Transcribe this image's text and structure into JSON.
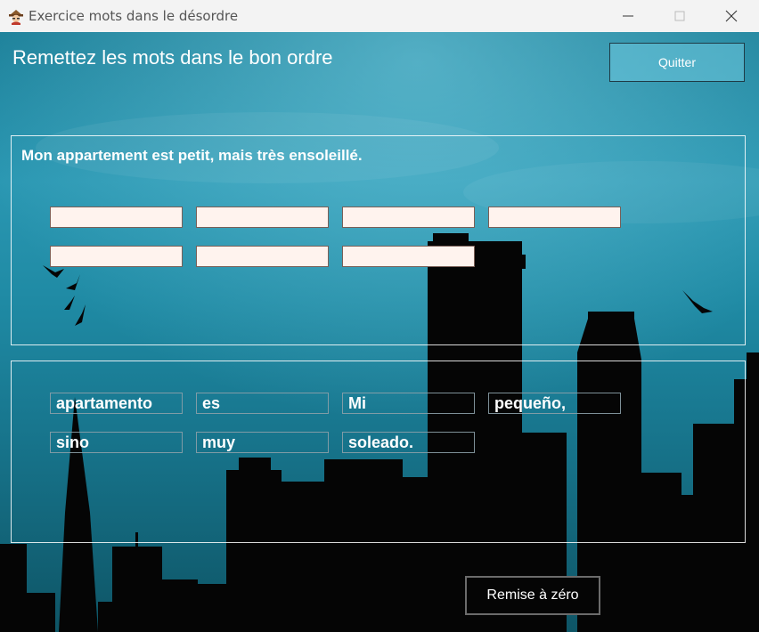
{
  "window": {
    "title": "Exercice mots dans le désordre",
    "app_icon": "detective-icon"
  },
  "heading": "Remettez les mots dans le bon ordre",
  "quit_label": "Quitter",
  "sentence": "Mon appartement est petit, mais très ensoleillé.",
  "answer_slots": [
    "",
    "",
    "",
    "",
    "",
    "",
    ""
  ],
  "words": [
    "apartamento",
    "es",
    "Mi",
    "pequeño,",
    "sino",
    "muy",
    "soleado."
  ],
  "reset_label": "Remise à zéro",
  "colors": {
    "sky_top": "#1b7f98",
    "sky_bottom": "#0e5566",
    "slot_fill": "#fff3ee",
    "silhouette": "#050505"
  }
}
